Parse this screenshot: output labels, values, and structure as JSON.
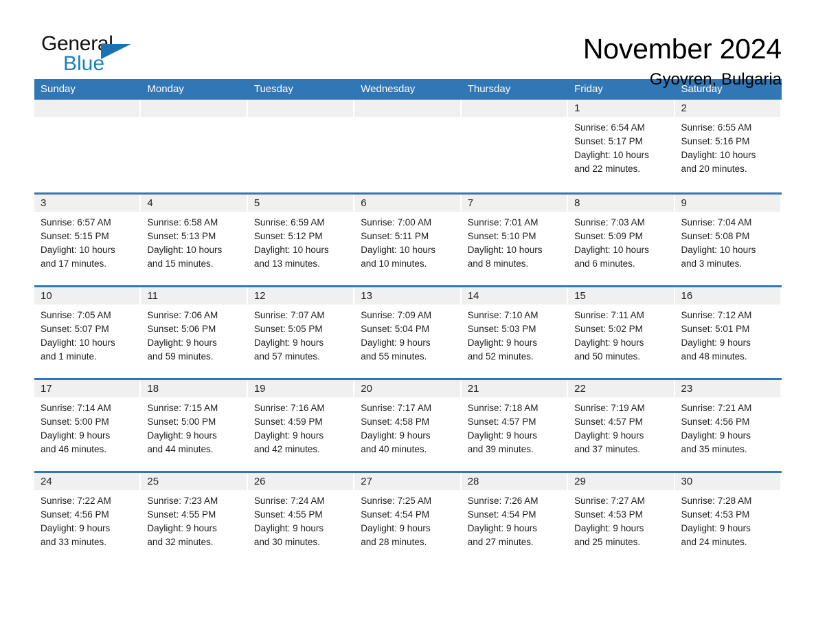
{
  "brand": {
    "name_part1": "General",
    "name_part2": "Blue",
    "accent_color": "#1a72b5"
  },
  "header": {
    "title": "November 2024",
    "subtitle": "Gyovren, Bulgaria"
  },
  "calendar": {
    "header_color": "#3277b5",
    "weekdays": [
      "Sunday",
      "Monday",
      "Tuesday",
      "Wednesday",
      "Thursday",
      "Friday",
      "Saturday"
    ],
    "weeks": [
      [
        {
          "day": "",
          "lines": []
        },
        {
          "day": "",
          "lines": []
        },
        {
          "day": "",
          "lines": []
        },
        {
          "day": "",
          "lines": []
        },
        {
          "day": "",
          "lines": []
        },
        {
          "day": "1",
          "lines": [
            "Sunrise: 6:54 AM",
            "Sunset: 5:17 PM",
            "Daylight: 10 hours",
            "and 22 minutes."
          ]
        },
        {
          "day": "2",
          "lines": [
            "Sunrise: 6:55 AM",
            "Sunset: 5:16 PM",
            "Daylight: 10 hours",
            "and 20 minutes."
          ]
        }
      ],
      [
        {
          "day": "3",
          "lines": [
            "Sunrise: 6:57 AM",
            "Sunset: 5:15 PM",
            "Daylight: 10 hours",
            "and 17 minutes."
          ]
        },
        {
          "day": "4",
          "lines": [
            "Sunrise: 6:58 AM",
            "Sunset: 5:13 PM",
            "Daylight: 10 hours",
            "and 15 minutes."
          ]
        },
        {
          "day": "5",
          "lines": [
            "Sunrise: 6:59 AM",
            "Sunset: 5:12 PM",
            "Daylight: 10 hours",
            "and 13 minutes."
          ]
        },
        {
          "day": "6",
          "lines": [
            "Sunrise: 7:00 AM",
            "Sunset: 5:11 PM",
            "Daylight: 10 hours",
            "and 10 minutes."
          ]
        },
        {
          "day": "7",
          "lines": [
            "Sunrise: 7:01 AM",
            "Sunset: 5:10 PM",
            "Daylight: 10 hours",
            "and 8 minutes."
          ]
        },
        {
          "day": "8",
          "lines": [
            "Sunrise: 7:03 AM",
            "Sunset: 5:09 PM",
            "Daylight: 10 hours",
            "and 6 minutes."
          ]
        },
        {
          "day": "9",
          "lines": [
            "Sunrise: 7:04 AM",
            "Sunset: 5:08 PM",
            "Daylight: 10 hours",
            "and 3 minutes."
          ]
        }
      ],
      [
        {
          "day": "10",
          "lines": [
            "Sunrise: 7:05 AM",
            "Sunset: 5:07 PM",
            "Daylight: 10 hours",
            "and 1 minute."
          ]
        },
        {
          "day": "11",
          "lines": [
            "Sunrise: 7:06 AM",
            "Sunset: 5:06 PM",
            "Daylight: 9 hours",
            "and 59 minutes."
          ]
        },
        {
          "day": "12",
          "lines": [
            "Sunrise: 7:07 AM",
            "Sunset: 5:05 PM",
            "Daylight: 9 hours",
            "and 57 minutes."
          ]
        },
        {
          "day": "13",
          "lines": [
            "Sunrise: 7:09 AM",
            "Sunset: 5:04 PM",
            "Daylight: 9 hours",
            "and 55 minutes."
          ]
        },
        {
          "day": "14",
          "lines": [
            "Sunrise: 7:10 AM",
            "Sunset: 5:03 PM",
            "Daylight: 9 hours",
            "and 52 minutes."
          ]
        },
        {
          "day": "15",
          "lines": [
            "Sunrise: 7:11 AM",
            "Sunset: 5:02 PM",
            "Daylight: 9 hours",
            "and 50 minutes."
          ]
        },
        {
          "day": "16",
          "lines": [
            "Sunrise: 7:12 AM",
            "Sunset: 5:01 PM",
            "Daylight: 9 hours",
            "and 48 minutes."
          ]
        }
      ],
      [
        {
          "day": "17",
          "lines": [
            "Sunrise: 7:14 AM",
            "Sunset: 5:00 PM",
            "Daylight: 9 hours",
            "and 46 minutes."
          ]
        },
        {
          "day": "18",
          "lines": [
            "Sunrise: 7:15 AM",
            "Sunset: 5:00 PM",
            "Daylight: 9 hours",
            "and 44 minutes."
          ]
        },
        {
          "day": "19",
          "lines": [
            "Sunrise: 7:16 AM",
            "Sunset: 4:59 PM",
            "Daylight: 9 hours",
            "and 42 minutes."
          ]
        },
        {
          "day": "20",
          "lines": [
            "Sunrise: 7:17 AM",
            "Sunset: 4:58 PM",
            "Daylight: 9 hours",
            "and 40 minutes."
          ]
        },
        {
          "day": "21",
          "lines": [
            "Sunrise: 7:18 AM",
            "Sunset: 4:57 PM",
            "Daylight: 9 hours",
            "and 39 minutes."
          ]
        },
        {
          "day": "22",
          "lines": [
            "Sunrise: 7:19 AM",
            "Sunset: 4:57 PM",
            "Daylight: 9 hours",
            "and 37 minutes."
          ]
        },
        {
          "day": "23",
          "lines": [
            "Sunrise: 7:21 AM",
            "Sunset: 4:56 PM",
            "Daylight: 9 hours",
            "and 35 minutes."
          ]
        }
      ],
      [
        {
          "day": "24",
          "lines": [
            "Sunrise: 7:22 AM",
            "Sunset: 4:56 PM",
            "Daylight: 9 hours",
            "and 33 minutes."
          ]
        },
        {
          "day": "25",
          "lines": [
            "Sunrise: 7:23 AM",
            "Sunset: 4:55 PM",
            "Daylight: 9 hours",
            "and 32 minutes."
          ]
        },
        {
          "day": "26",
          "lines": [
            "Sunrise: 7:24 AM",
            "Sunset: 4:55 PM",
            "Daylight: 9 hours",
            "and 30 minutes."
          ]
        },
        {
          "day": "27",
          "lines": [
            "Sunrise: 7:25 AM",
            "Sunset: 4:54 PM",
            "Daylight: 9 hours",
            "and 28 minutes."
          ]
        },
        {
          "day": "28",
          "lines": [
            "Sunrise: 7:26 AM",
            "Sunset: 4:54 PM",
            "Daylight: 9 hours",
            "and 27 minutes."
          ]
        },
        {
          "day": "29",
          "lines": [
            "Sunrise: 7:27 AM",
            "Sunset: 4:53 PM",
            "Daylight: 9 hours",
            "and 25 minutes."
          ]
        },
        {
          "day": "30",
          "lines": [
            "Sunrise: 7:28 AM",
            "Sunset: 4:53 PM",
            "Daylight: 9 hours",
            "and 24 minutes."
          ]
        }
      ]
    ]
  }
}
